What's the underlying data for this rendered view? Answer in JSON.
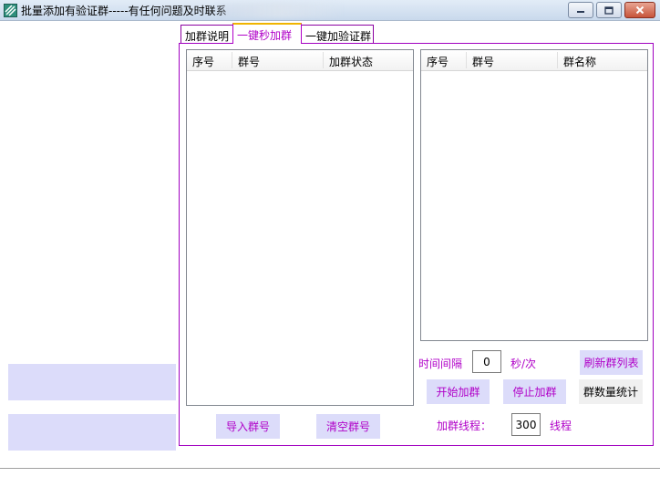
{
  "window": {
    "title": "批量添加有验证群-----有任何问题及时联系",
    "icon": "app-stripes-icon",
    "controls": [
      "minimize-icon",
      "maximize-icon",
      "close-icon"
    ]
  },
  "tabs": [
    {
      "label": "加群说明",
      "active": false
    },
    {
      "label": "一键秒加群",
      "active": true
    },
    {
      "label": "一键加验证群",
      "active": false
    }
  ],
  "left_list": {
    "columns": [
      "序号",
      "群号",
      "加群状态"
    ],
    "rows": []
  },
  "right_list": {
    "columns": [
      "序号",
      "群号",
      "群名称"
    ],
    "rows": []
  },
  "controls": {
    "interval_label": "时间间隔",
    "interval_value": "0",
    "interval_unit": "秒/次",
    "threads_label": "加群线程：",
    "threads_value": "300",
    "threads_unit": "线程"
  },
  "buttons": {
    "import": "导入群号",
    "clear": "清空群号",
    "start": "开始加群",
    "stop": "停止加群",
    "refresh": "刷新群列表",
    "stats": "群数量统计"
  },
  "colors": {
    "accent": "#b000c8",
    "button_bg": "#dcdcfa",
    "tab_border": "#a000c0"
  }
}
